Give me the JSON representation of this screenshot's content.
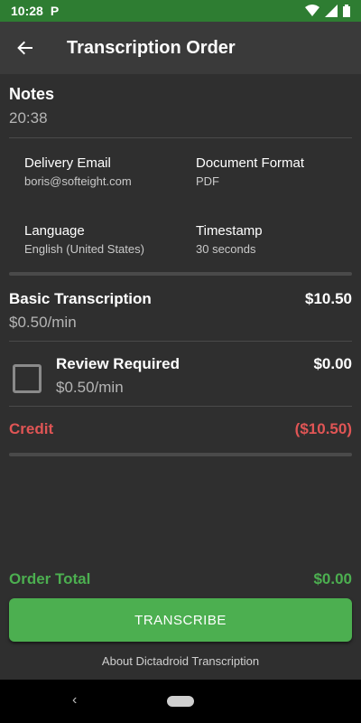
{
  "status_bar": {
    "time": "10:28",
    "app_badge": "P"
  },
  "app_bar": {
    "title": "Transcription Order"
  },
  "notes": {
    "title": "Notes",
    "duration": "20:38"
  },
  "details": {
    "delivery_email_label": "Delivery Email",
    "delivery_email_value": "boris@softeight.com",
    "document_format_label": "Document Format",
    "document_format_value": "PDF",
    "language_label": "Language",
    "language_value": "English (United States)",
    "timestamp_label": "Timestamp",
    "timestamp_value": "30 seconds"
  },
  "basic": {
    "title": "Basic Transcription",
    "rate": "$0.50/min",
    "price": "$10.50"
  },
  "review": {
    "title": "Review Required",
    "rate": "$0.50/min",
    "price": "$0.00",
    "checked": false
  },
  "credit": {
    "label": "Credit",
    "amount": "($10.50)"
  },
  "total": {
    "label": "Order Total",
    "amount": "$0.00"
  },
  "actions": {
    "transcribe_label": "TRANSCRIBE",
    "about_label": "About Dictadroid Transcription"
  },
  "colors": {
    "status_bar": "#2e7d32",
    "app_bar": "#3a3a3a",
    "background": "#2f2f2f",
    "accent_green": "#4caf50",
    "credit_red": "#e05555"
  }
}
